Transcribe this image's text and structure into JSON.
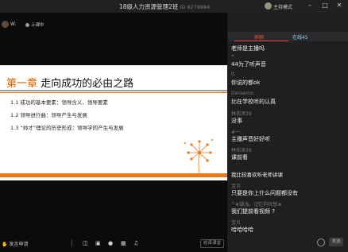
{
  "window": {
    "title": "18级人力资源管理2班",
    "meeting_id": "ID 8278884",
    "host_mode_label": "主持模式"
  },
  "teacher": {
    "name": "W.",
    "live_label": "上课中"
  },
  "slide": {
    "chapter": "第一章",
    "title": "走向成功的必由之路",
    "bullets": [
      "1.1  成功的基本要素：领导含义、领导要素",
      "1.2  领导进行曲：领导产生与发展",
      "1.3  “帅才”理论的历史形成：领导学的产生与发展"
    ]
  },
  "toolbar": {
    "raise_hand_label": "发言申请",
    "end_button": "结束课堂"
  },
  "sidebar": {
    "tabs": [
      {
        "label": "群聊"
      },
      {
        "label": "在线45"
      }
    ],
    "messages": [
      {
        "name": "",
        "text": "老师是主播吗"
      },
      {
        "name": "•",
        "text": "44为了听声音"
      },
      {
        "name": "lt.",
        "text": "你说的都ok"
      },
      {
        "name": "Doraemo.",
        "text": "比在学校听的认真"
      },
      {
        "name": "林伟添39",
        "text": "没事"
      },
      {
        "name": "#一.",
        "text": "主播声音好好听"
      },
      {
        "name": "林伟添39",
        "text": "课前看"
      }
    ],
    "messages2": [
      {
        "name": "",
        "text": "我比较喜欢听老师讲课"
      },
      {
        "name": "宝贝",
        "text": "只要是你上什么问题都没有"
      },
      {
        "name": "^★瑚浅。记忆的忧愁★",
        "text": "我们提前看视频    ?"
      },
      {
        "name": "宝贝",
        "text": "哈哈哈哈"
      }
    ],
    "send_label": "发送"
  }
}
